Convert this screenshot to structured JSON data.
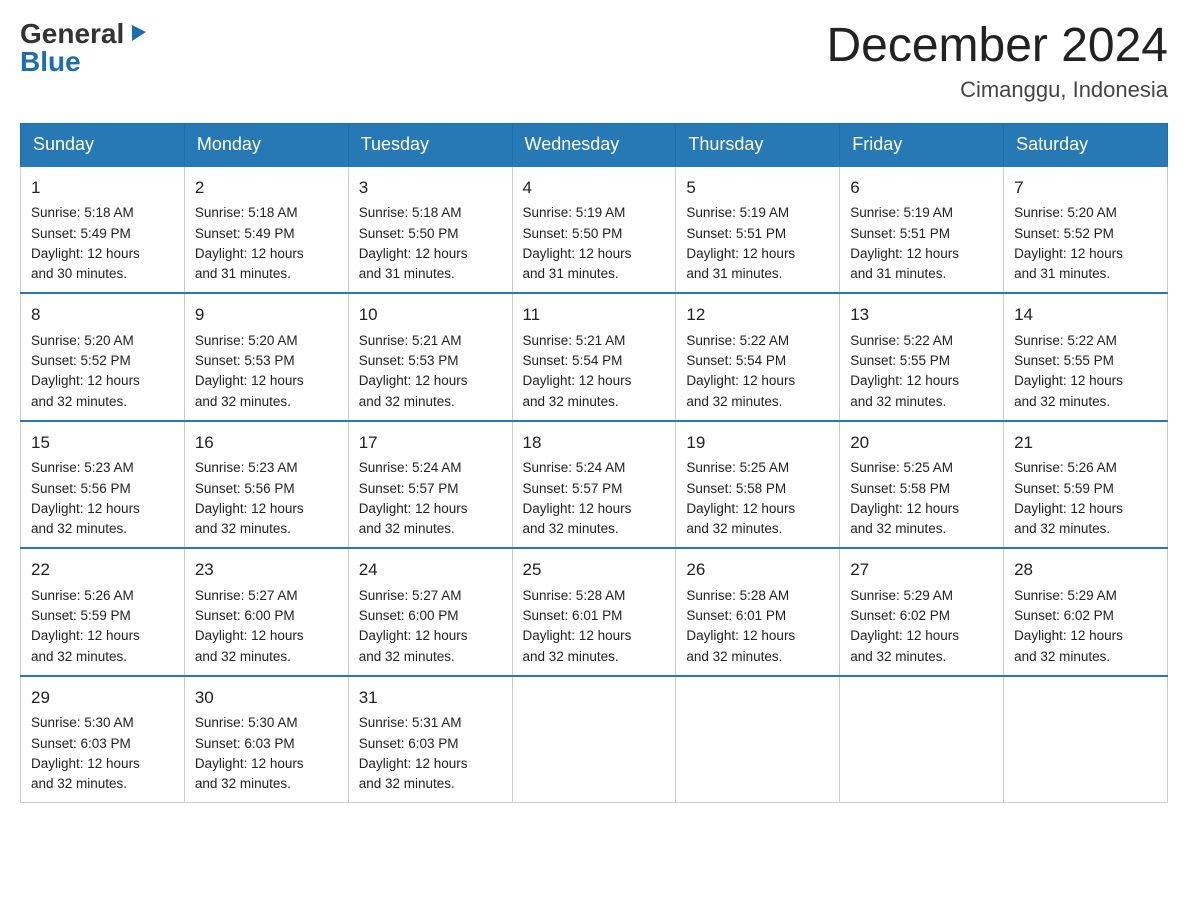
{
  "logo": {
    "general": "General",
    "arrow": "▶",
    "blue": "Blue"
  },
  "header": {
    "month_title": "December 2024",
    "location": "Cimanggu, Indonesia"
  },
  "weekdays": [
    "Sunday",
    "Monday",
    "Tuesday",
    "Wednesday",
    "Thursday",
    "Friday",
    "Saturday"
  ],
  "weeks": [
    [
      {
        "day": "1",
        "sunrise": "5:18 AM",
        "sunset": "5:49 PM",
        "daylight": "12 hours and 30 minutes."
      },
      {
        "day": "2",
        "sunrise": "5:18 AM",
        "sunset": "5:49 PM",
        "daylight": "12 hours and 31 minutes."
      },
      {
        "day": "3",
        "sunrise": "5:18 AM",
        "sunset": "5:50 PM",
        "daylight": "12 hours and 31 minutes."
      },
      {
        "day": "4",
        "sunrise": "5:19 AM",
        "sunset": "5:50 PM",
        "daylight": "12 hours and 31 minutes."
      },
      {
        "day": "5",
        "sunrise": "5:19 AM",
        "sunset": "5:51 PM",
        "daylight": "12 hours and 31 minutes."
      },
      {
        "day": "6",
        "sunrise": "5:19 AM",
        "sunset": "5:51 PM",
        "daylight": "12 hours and 31 minutes."
      },
      {
        "day": "7",
        "sunrise": "5:20 AM",
        "sunset": "5:52 PM",
        "daylight": "12 hours and 31 minutes."
      }
    ],
    [
      {
        "day": "8",
        "sunrise": "5:20 AM",
        "sunset": "5:52 PM",
        "daylight": "12 hours and 32 minutes."
      },
      {
        "day": "9",
        "sunrise": "5:20 AM",
        "sunset": "5:53 PM",
        "daylight": "12 hours and 32 minutes."
      },
      {
        "day": "10",
        "sunrise": "5:21 AM",
        "sunset": "5:53 PM",
        "daylight": "12 hours and 32 minutes."
      },
      {
        "day": "11",
        "sunrise": "5:21 AM",
        "sunset": "5:54 PM",
        "daylight": "12 hours and 32 minutes."
      },
      {
        "day": "12",
        "sunrise": "5:22 AM",
        "sunset": "5:54 PM",
        "daylight": "12 hours and 32 minutes."
      },
      {
        "day": "13",
        "sunrise": "5:22 AM",
        "sunset": "5:55 PM",
        "daylight": "12 hours and 32 minutes."
      },
      {
        "day": "14",
        "sunrise": "5:22 AM",
        "sunset": "5:55 PM",
        "daylight": "12 hours and 32 minutes."
      }
    ],
    [
      {
        "day": "15",
        "sunrise": "5:23 AM",
        "sunset": "5:56 PM",
        "daylight": "12 hours and 32 minutes."
      },
      {
        "day": "16",
        "sunrise": "5:23 AM",
        "sunset": "5:56 PM",
        "daylight": "12 hours and 32 minutes."
      },
      {
        "day": "17",
        "sunrise": "5:24 AM",
        "sunset": "5:57 PM",
        "daylight": "12 hours and 32 minutes."
      },
      {
        "day": "18",
        "sunrise": "5:24 AM",
        "sunset": "5:57 PM",
        "daylight": "12 hours and 32 minutes."
      },
      {
        "day": "19",
        "sunrise": "5:25 AM",
        "sunset": "5:58 PM",
        "daylight": "12 hours and 32 minutes."
      },
      {
        "day": "20",
        "sunrise": "5:25 AM",
        "sunset": "5:58 PM",
        "daylight": "12 hours and 32 minutes."
      },
      {
        "day": "21",
        "sunrise": "5:26 AM",
        "sunset": "5:59 PM",
        "daylight": "12 hours and 32 minutes."
      }
    ],
    [
      {
        "day": "22",
        "sunrise": "5:26 AM",
        "sunset": "5:59 PM",
        "daylight": "12 hours and 32 minutes."
      },
      {
        "day": "23",
        "sunrise": "5:27 AM",
        "sunset": "6:00 PM",
        "daylight": "12 hours and 32 minutes."
      },
      {
        "day": "24",
        "sunrise": "5:27 AM",
        "sunset": "6:00 PM",
        "daylight": "12 hours and 32 minutes."
      },
      {
        "day": "25",
        "sunrise": "5:28 AM",
        "sunset": "6:01 PM",
        "daylight": "12 hours and 32 minutes."
      },
      {
        "day": "26",
        "sunrise": "5:28 AM",
        "sunset": "6:01 PM",
        "daylight": "12 hours and 32 minutes."
      },
      {
        "day": "27",
        "sunrise": "5:29 AM",
        "sunset": "6:02 PM",
        "daylight": "12 hours and 32 minutes."
      },
      {
        "day": "28",
        "sunrise": "5:29 AM",
        "sunset": "6:02 PM",
        "daylight": "12 hours and 32 minutes."
      }
    ],
    [
      {
        "day": "29",
        "sunrise": "5:30 AM",
        "sunset": "6:03 PM",
        "daylight": "12 hours and 32 minutes."
      },
      {
        "day": "30",
        "sunrise": "5:30 AM",
        "sunset": "6:03 PM",
        "daylight": "12 hours and 32 minutes."
      },
      {
        "day": "31",
        "sunrise": "5:31 AM",
        "sunset": "6:03 PM",
        "daylight": "12 hours and 32 minutes."
      },
      null,
      null,
      null,
      null
    ]
  ],
  "labels": {
    "sunrise": "Sunrise:",
    "sunset": "Sunset:",
    "daylight": "Daylight:"
  }
}
